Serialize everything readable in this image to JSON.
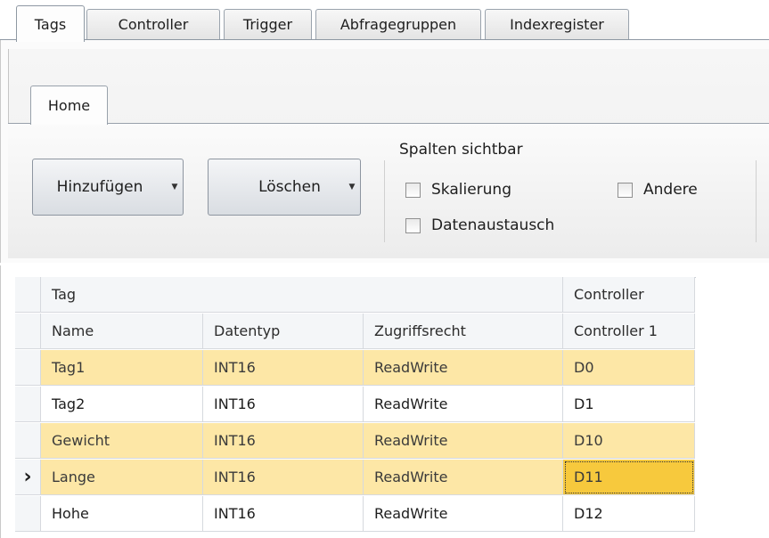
{
  "tabs": [
    "Tags",
    "Controller",
    "Trigger",
    "Abfragegruppen",
    "Indexregister"
  ],
  "ribbon": {
    "home_tab": "Home",
    "add_button": "Hinzufügen",
    "delete_button": "Löschen",
    "columns_group_title": "Spalten sichtbar",
    "checkboxes": {
      "skalierung": "Skalierung",
      "andere": "Andere",
      "datenaustausch": "Datenaustausch"
    }
  },
  "grid": {
    "group_tag": "Tag",
    "group_controller": "Controller",
    "columns": [
      "Name",
      "Datentyp",
      "Zugriffsrecht",
      "Controller 1"
    ],
    "current_row_marker": "›",
    "rows": [
      {
        "name": "Tag1",
        "type": "INT16",
        "access": "ReadWrite",
        "address": "D0"
      },
      {
        "name": "Tag2",
        "type": "INT16",
        "access": "ReadWrite",
        "address": "D1"
      },
      {
        "name": "Gewicht",
        "type": "INT16",
        "access": "ReadWrite",
        "address": "D10"
      },
      {
        "name": "Lange",
        "type": "INT16",
        "access": "ReadWrite",
        "address": "D11"
      },
      {
        "name": "Hohe",
        "type": "INT16",
        "access": "ReadWrite",
        "address": "D12"
      }
    ]
  },
  "colors": {
    "row_highlight": "#fde7a6",
    "selected_cell": "#f7c93d"
  }
}
